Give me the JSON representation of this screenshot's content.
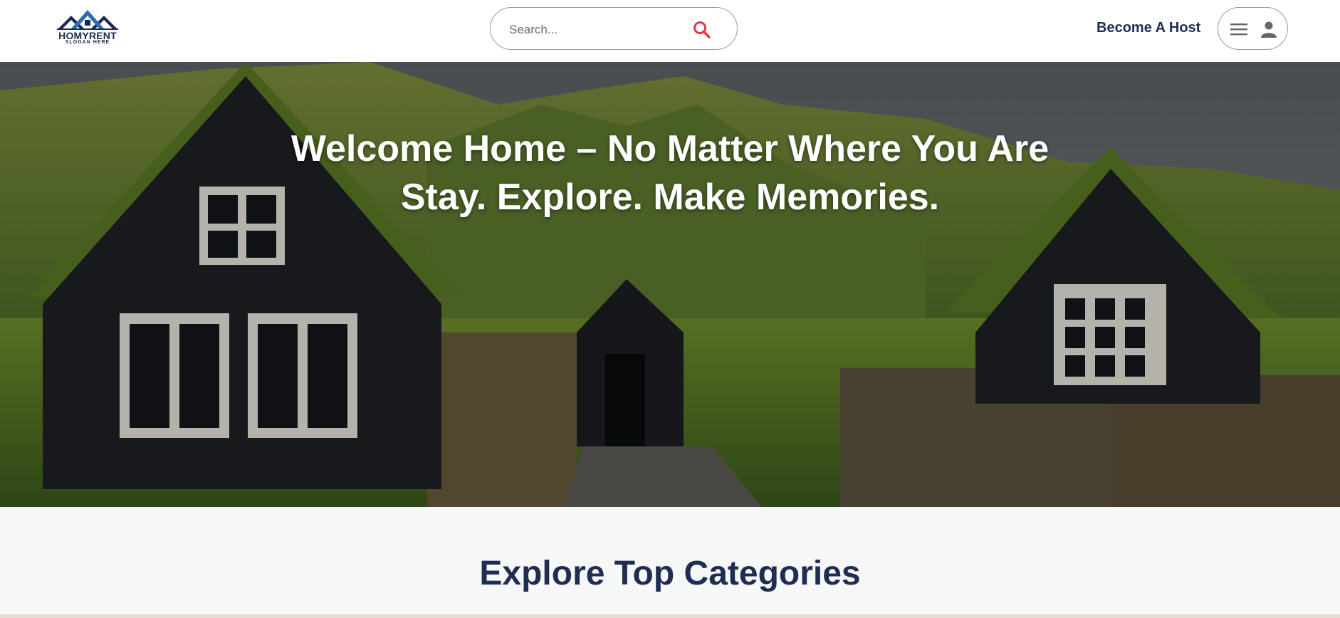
{
  "header": {
    "logo": {
      "brand": "HOMYRENT",
      "slogan": "SLOGAN HERE",
      "icon": "house-roofs-logo"
    },
    "search": {
      "placeholder": "Search...",
      "value": "",
      "icon": "search-icon"
    },
    "host_link": "Become A Host",
    "user_menu": {
      "menu_icon": "hamburger-icon",
      "user_icon": "user-icon"
    }
  },
  "hero": {
    "title_line1": "Welcome Home – No Matter Where You Are",
    "title_line2": "Stay. Explore. Make Memories.",
    "image": "turf-roof-houses-landscape"
  },
  "categories": {
    "heading": "Explore Top Categories"
  },
  "colors": {
    "brand_navy": "#1f2d52",
    "search_accent": "#e8334a",
    "background": "#f6f7f7"
  }
}
